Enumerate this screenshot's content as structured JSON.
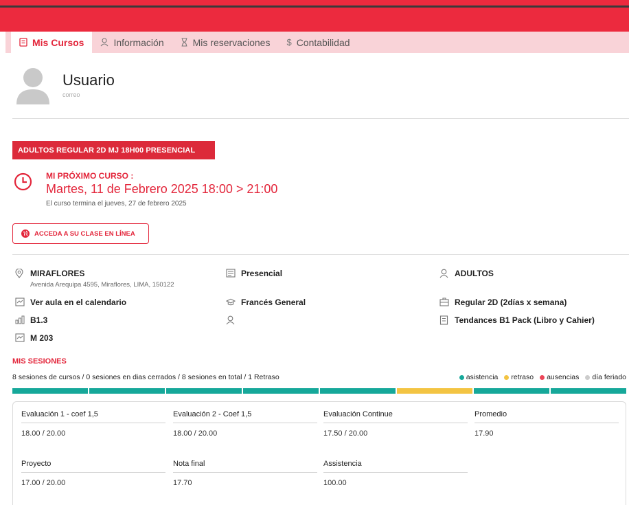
{
  "colors": {
    "accent": "#e3263b",
    "topbar": "#ec2a3e",
    "tabs_bg": "#f9d3d8",
    "asistencia": "#16a89a",
    "retraso": "#f3c443",
    "ausencias": "#ec4558",
    "feriado": "#cccccc"
  },
  "tabs": [
    {
      "label": "Mis Cursos",
      "icon": "book-icon"
    },
    {
      "label": "Información",
      "icon": "user-icon"
    },
    {
      "label": "Mis reservaciones",
      "icon": "hourglass-icon"
    },
    {
      "label": "Contabilidad",
      "icon": "dollar-icon"
    }
  ],
  "user": {
    "name": "Usuario",
    "email": "correo"
  },
  "course": {
    "badge": "ADULTOS REGULAR 2D MJ 18H00 PRESENCIAL",
    "next_label": "MI PRÓXIMO CURSO :",
    "next_date": "Martes, 11 de Febrero 2025 18:00 > 21:00",
    "end_text": "El curso termina el jueves, 27 de febrero 2025",
    "online_button": "ACCEDA A SU CLASE EN LÍNEA"
  },
  "info": {
    "location": "MIRAFLORES",
    "address": "Avenida Arequipa 4595, Miraflores, LIMA, 150122",
    "modality": "Presencial",
    "audience": "ADULTOS",
    "calendar_link": "Ver aula en el calendario",
    "program": "Francés General",
    "schedule": "Regular 2D (2días x semana)",
    "level": "B1.3",
    "teacher": "",
    "book": "Tendances B1 Pack (Libro y Cahier)",
    "room": "M 203"
  },
  "sessions": {
    "title": "MIS SESIONES",
    "summary": "8 sesiones de cursos / 0 sesiones en dias cerrados / 8 sesiones en total / 1 Retraso",
    "legend": {
      "asistencia": "asistencia",
      "retraso": "retraso",
      "ausencias": "ausencias",
      "feriado": "día feriado"
    },
    "bar": [
      "asistencia",
      "asistencia",
      "asistencia",
      "asistencia",
      "asistencia",
      "retraso",
      "asistencia",
      "asistencia"
    ]
  },
  "grades": [
    {
      "label": "Evaluación 1 - coef 1,5",
      "value": "18.00 / 20.00"
    },
    {
      "label": "Evaluación 2 - Coef 1,5",
      "value": "18.00 / 20.00"
    },
    {
      "label": "Evaluación Continue",
      "value": "17.50 / 20.00"
    },
    {
      "label": "Promedio",
      "value": "17.90"
    },
    {
      "label": "Proyecto",
      "value": "17.00 / 20.00"
    },
    {
      "label": "Nota final",
      "value": "17.70"
    },
    {
      "label": "Assistencia",
      "value": "100.00"
    }
  ]
}
